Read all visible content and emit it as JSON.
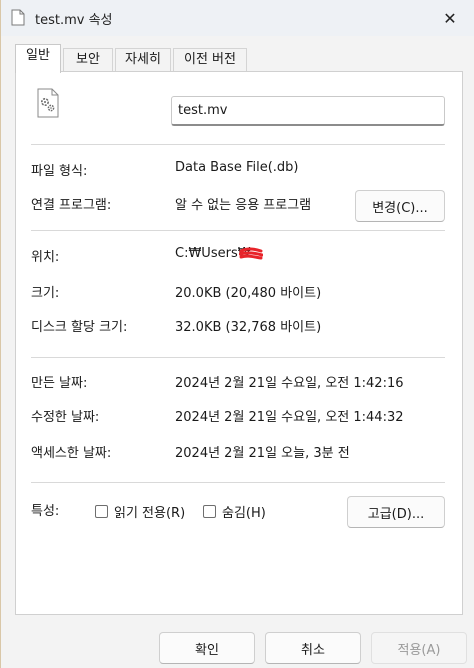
{
  "window": {
    "title": "test.mv 속성",
    "close_glyph": "✕"
  },
  "tabs": [
    {
      "label": "일반",
      "active": true
    },
    {
      "label": "보안",
      "active": false
    },
    {
      "label": "자세히",
      "active": false
    },
    {
      "label": "이전 버전",
      "active": false
    }
  ],
  "general": {
    "file_icon": "settings-file-icon",
    "file_name": "test.mv",
    "file_type_label": "파일 형식:",
    "file_type_value": "Data Base File(.db)",
    "opens_with_label": "연결 프로그램:",
    "opens_with_value": "알 수 없는 응용 프로그램",
    "change_button": "변경(C)...",
    "location_label": "위치:",
    "location_value": "C:₩Users₩",
    "size_label": "크기:",
    "size_value": "20.0KB (20,480 바이트)",
    "size_on_disk_label": "디스크 할당 크기:",
    "size_on_disk_value": "32.0KB (32,768 바이트)",
    "created_label": "만든 날짜:",
    "created_value": "2024년 2월 21일 수요일, 오전 1:42:16",
    "modified_label": "수정한 날짜:",
    "modified_value": "2024년 2월 21일 수요일, 오전 1:44:32",
    "accessed_label": "액세스한 날짜:",
    "accessed_value": "2024년 2월 21일 오늘, 3분 전",
    "attributes_label": "특성:",
    "readonly_label": "읽기 전용(R)",
    "readonly_checked": false,
    "hidden_label": "숨김(H)",
    "hidden_checked": false,
    "advanced_button": "고급(D)..."
  },
  "footer": {
    "ok_button": "확인",
    "cancel_button": "취소",
    "apply_button": "적용(A)"
  },
  "colors": {
    "redaction": "#e8242a",
    "disabled_text": "#9a9a9a"
  }
}
